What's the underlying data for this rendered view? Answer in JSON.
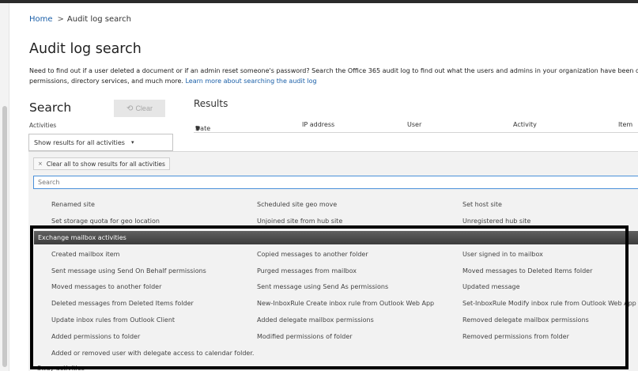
{
  "breadcrumb": {
    "home": "Home",
    "separator": ">",
    "current": "Audit log search"
  },
  "page": {
    "title": "Audit log search",
    "description_line1": "Need to find out if a user deleted a document or if an admin reset someone's password? Search the Office 365 audit log to find out what the users and admins in your organization have been doing. You'll find a",
    "description_line2": "permissions, directory services, and much more.",
    "learn_more_link": "Learn more about searching the audit log"
  },
  "search": {
    "heading": "Search",
    "clear_label": "Clear",
    "clear_icon": "undo-icon",
    "activities_label": "Activities",
    "activities_value": "Show results for all activities",
    "activities_caret": "▾"
  },
  "results": {
    "title": "Results",
    "columns": {
      "date": "Date",
      "date_sort": "▼",
      "ip": "IP address",
      "user": "User",
      "activity": "Activity",
      "item": "Item"
    }
  },
  "dropdown": {
    "clear_all_chip": "Clear all to show results for all activities",
    "chip_x": "×",
    "search_placeholder": "Search",
    "top_rows": [
      [
        "Renamed site",
        "Scheduled site geo move",
        "Set host site"
      ],
      [
        "Set storage quota for geo location",
        "Unjoined site from hub site",
        "Unregistered hub site"
      ]
    ],
    "group_header": "Exchange mailbox activities",
    "group_rows": [
      [
        "Created mailbox item",
        "Copied messages to another folder",
        "User signed in to mailbox"
      ],
      [
        "Sent message using Send On Behalf permissions",
        "Purged messages from mailbox",
        "Moved messages to Deleted Items folder"
      ],
      [
        "Moved messages to another folder",
        "Sent message using Send As permissions",
        "Updated message"
      ],
      [
        "Deleted messages from Deleted Items folder",
        "New-InboxRule Create inbox rule from Outlook Web App",
        "Set-InboxRule Modify inbox rule from Outlook Web App"
      ],
      [
        "Update inbox rules from Outlook Client",
        "Added delegate mailbox permissions",
        "Removed delegate mailbox permissions"
      ],
      [
        "Added permissions to folder",
        "Modified permissions of folder",
        "Removed permissions from folder"
      ],
      [
        "Added or removed user with delegate access to calendar folder.",
        "",
        ""
      ]
    ],
    "next_group_partial": "Sway activities"
  },
  "colors": {
    "link": "#1a5fa8",
    "group_header_bg": "#4a4a4a",
    "highlight_border": "#000000",
    "search_border": "#4a90d9"
  }
}
